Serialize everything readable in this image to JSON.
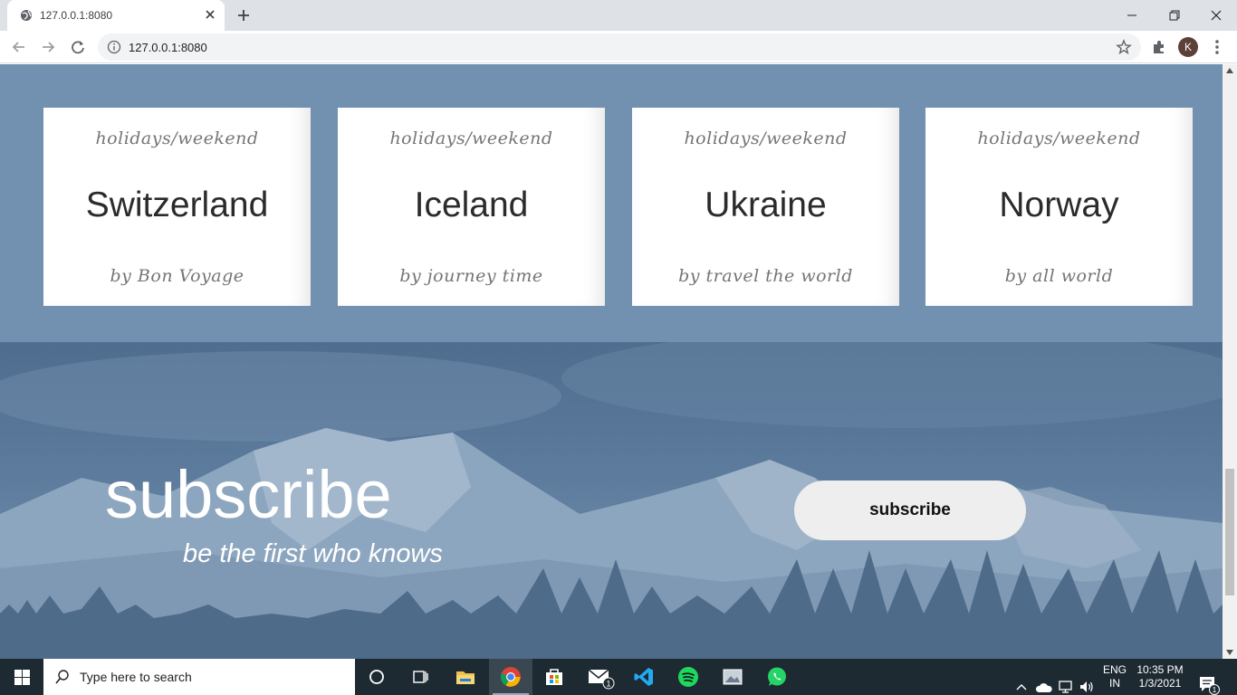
{
  "browser": {
    "tab_title": "127.0.0.1:8080",
    "url": "127.0.0.1:8080",
    "profile_initial": "K"
  },
  "cards": [
    {
      "category": "holidays/weekend",
      "title": "Switzerland",
      "author": "by Bon Voyage"
    },
    {
      "category": "holidays/weekend",
      "title": "Iceland",
      "author": "by journey time"
    },
    {
      "category": "holidays/weekend",
      "title": "Ukraine",
      "author": "by travel the world"
    },
    {
      "category": "holidays/weekend",
      "title": "Norway",
      "author": "by all world"
    }
  ],
  "subscribe": {
    "heading": "subscribe",
    "tagline": "be the first who knows",
    "button_label": "subscribe"
  },
  "taskbar": {
    "search_placeholder": "Type here to search",
    "mail_badge": "1",
    "lang_line1": "ENG",
    "lang_line2": "IN",
    "time": "10:35 PM",
    "date": "1/3/2021",
    "notification_count": "1"
  },
  "colors": {
    "cards_bg": "#7291b0",
    "subscribe_bg": "#5c7b9c",
    "button_bg": "#eeeeee"
  }
}
